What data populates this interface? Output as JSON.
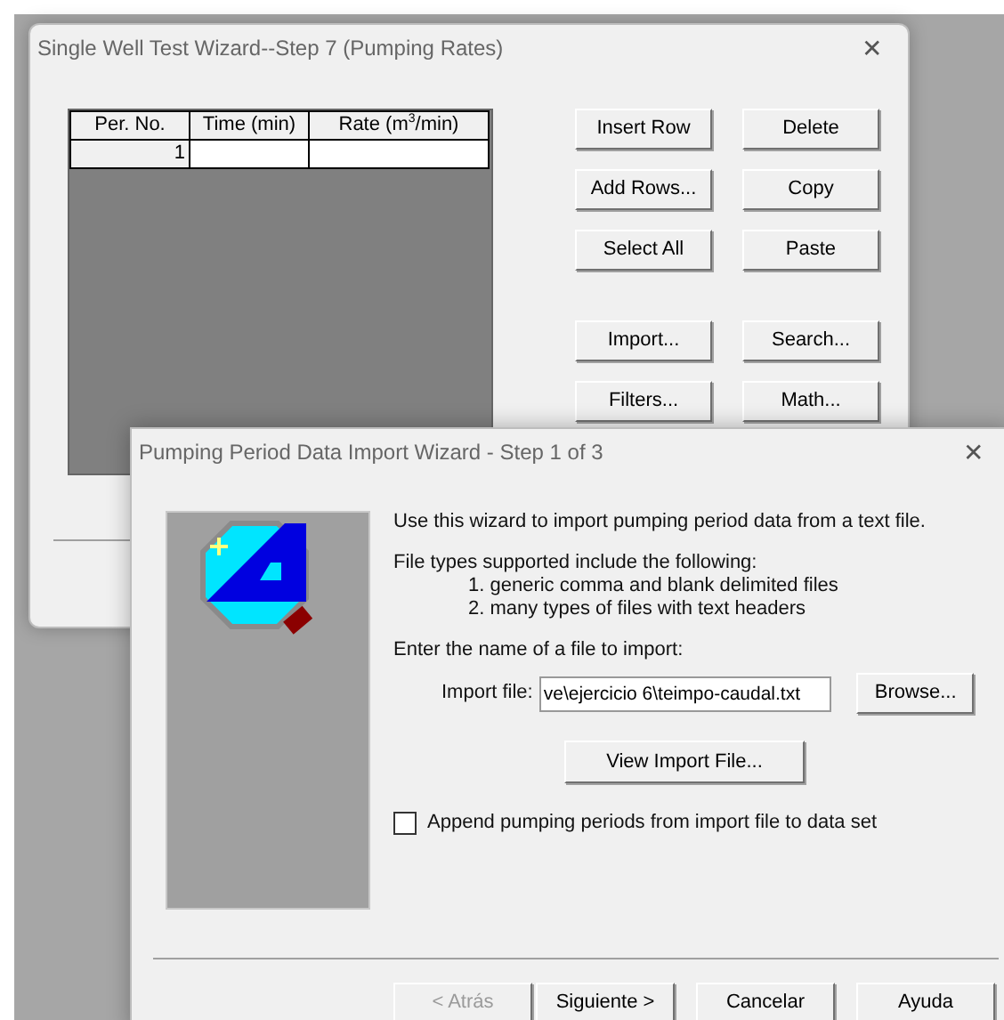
{
  "back_window": {
    "title": "Single Well Test Wizard--Step 7 (Pumping Rates)",
    "close": "✕",
    "table": {
      "columns": [
        "Per. No.",
        "Time (min)",
        "Rate (m$^{3}$/min)"
      ],
      "rows": [
        [
          "1",
          "",
          ""
        ]
      ]
    },
    "buttons": [
      {
        "label": "Insert Row"
      },
      {
        "label": "Delete"
      },
      {
        "label": "Add Rows..."
      },
      {
        "label": "Copy"
      },
      {
        "label": "Select All"
      },
      {
        "label": "Paste"
      },
      {
        "label": "Import..."
      },
      {
        "label": "Search..."
      },
      {
        "label": "Filters..."
      },
      {
        "label": "Math..."
      }
    ]
  },
  "import_wizard": {
    "title": "Pumping Period Data Import Wizard -  Step 1 of 3",
    "close": "✕",
    "intro": "Use this wizard to import pumping period data from a text file.",
    "types_heading": "File types supported include the following:",
    "types": [
      "1.  generic comma and blank delimited files",
      "2.  many types of files with text headers"
    ],
    "enter_prompt": "Enter the name of a file to import:",
    "import_file": {
      "label": "Import file:",
      "value": "ve\\ejercicio 6\\teimpo-caudal.txt"
    },
    "browse_button": "Browse...",
    "view_button": "View Import File...",
    "append": {
      "label": "Append pumping periods from import file to data set",
      "checked": false
    },
    "nav_buttons": [
      {
        "label": "< Atrás",
        "disabled": true
      },
      {
        "label": "Siguiente >",
        "disabled": false
      },
      {
        "label": "Cancelar",
        "disabled": false
      },
      {
        "label": "Ayuda",
        "disabled": false
      }
    ]
  }
}
